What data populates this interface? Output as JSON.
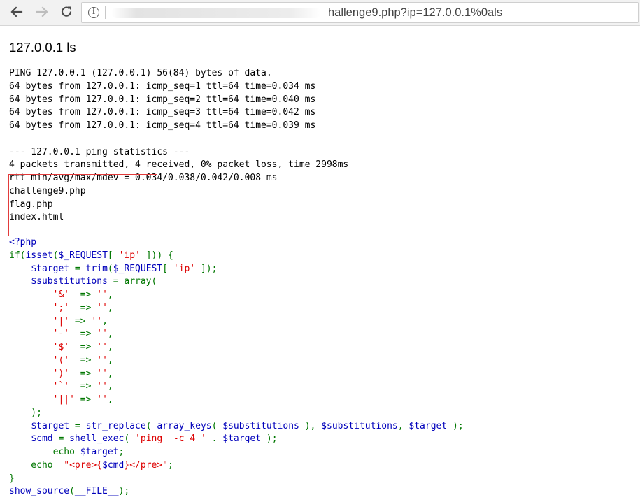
{
  "browser": {
    "url_visible": "hallenge9.php?ip=127.0.0.1%0als",
    "icons": {
      "back": "back-arrow-icon",
      "forward": "forward-arrow-icon",
      "reload": "reload-icon",
      "info": "info-icon"
    },
    "info_glyph": "i"
  },
  "page": {
    "heading": "127.0.0.1 ls",
    "output_lines": [
      "PING 127.0.0.1 (127.0.0.1) 56(84) bytes of data.",
      "64 bytes from 127.0.0.1: icmp_seq=1 ttl=64 time=0.034 ms",
      "64 bytes from 127.0.0.1: icmp_seq=2 ttl=64 time=0.040 ms",
      "64 bytes from 127.0.0.1: icmp_seq=3 ttl=64 time=0.042 ms",
      "64 bytes from 127.0.0.1: icmp_seq=4 ttl=64 time=0.039 ms",
      "",
      "--- 127.0.0.1 ping statistics ---",
      "4 packets transmitted, 4 received, 0% packet loss, time 2998ms",
      "rtt min/avg/max/mdev = 0.034/0.038/0.042/0.008 ms",
      "challenge9.php",
      "flag.php",
      "index.html"
    ],
    "highlight_color": "#e23b3b"
  },
  "source": {
    "colors": {
      "default": "#0000bb",
      "keyword": "#007700",
      "string": "#dd0000"
    },
    "lines": [
      [
        [
          "default",
          "<?php"
        ]
      ],
      [
        [
          "keyword",
          "if("
        ],
        [
          "default",
          "isset"
        ],
        [
          "keyword",
          "("
        ],
        [
          "default",
          "$_REQUEST"
        ],
        [
          "keyword",
          "[ "
        ],
        [
          "string",
          "'ip'"
        ],
        [
          "keyword",
          " ])) {"
        ]
      ],
      [
        [
          "keyword",
          "    "
        ],
        [
          "default",
          "$target"
        ],
        [
          "keyword",
          " = "
        ],
        [
          "default",
          "trim"
        ],
        [
          "keyword",
          "("
        ],
        [
          "default",
          "$_REQUEST"
        ],
        [
          "keyword",
          "[ "
        ],
        [
          "string",
          "'ip'"
        ],
        [
          "keyword",
          " ]);"
        ]
      ],
      [
        [
          "keyword",
          "    "
        ],
        [
          "default",
          "$substitutions"
        ],
        [
          "keyword",
          " = array("
        ]
      ],
      [
        [
          "keyword",
          "        "
        ],
        [
          "string",
          "'&'"
        ],
        [
          "keyword",
          "  => "
        ],
        [
          "string",
          "''"
        ],
        [
          "keyword",
          ","
        ]
      ],
      [
        [
          "keyword",
          "        "
        ],
        [
          "string",
          "';'"
        ],
        [
          "keyword",
          "  => "
        ],
        [
          "string",
          "''"
        ],
        [
          "keyword",
          ","
        ]
      ],
      [
        [
          "keyword",
          "        "
        ],
        [
          "string",
          "'|'"
        ],
        [
          "keyword",
          " => "
        ],
        [
          "string",
          "''"
        ],
        [
          "keyword",
          ","
        ]
      ],
      [
        [
          "keyword",
          "        "
        ],
        [
          "string",
          "'-'"
        ],
        [
          "keyword",
          "  => "
        ],
        [
          "string",
          "''"
        ],
        [
          "keyword",
          ","
        ]
      ],
      [
        [
          "keyword",
          "        "
        ],
        [
          "string",
          "'$'"
        ],
        [
          "keyword",
          "  => "
        ],
        [
          "string",
          "''"
        ],
        [
          "keyword",
          ","
        ]
      ],
      [
        [
          "keyword",
          "        "
        ],
        [
          "string",
          "'('"
        ],
        [
          "keyword",
          "  => "
        ],
        [
          "string",
          "''"
        ],
        [
          "keyword",
          ","
        ]
      ],
      [
        [
          "keyword",
          "        "
        ],
        [
          "string",
          "')'"
        ],
        [
          "keyword",
          "  => "
        ],
        [
          "string",
          "''"
        ],
        [
          "keyword",
          ","
        ]
      ],
      [
        [
          "keyword",
          "        "
        ],
        [
          "string",
          "'`'"
        ],
        [
          "keyword",
          "  => "
        ],
        [
          "string",
          "''"
        ],
        [
          "keyword",
          ","
        ]
      ],
      [
        [
          "keyword",
          "        "
        ],
        [
          "string",
          "'||'"
        ],
        [
          "keyword",
          " => "
        ],
        [
          "string",
          "''"
        ],
        [
          "keyword",
          ","
        ]
      ],
      [
        [
          "keyword",
          "    );"
        ]
      ],
      [
        [
          "keyword",
          "    "
        ],
        [
          "default",
          "$target"
        ],
        [
          "keyword",
          " = "
        ],
        [
          "default",
          "str_replace"
        ],
        [
          "keyword",
          "( "
        ],
        [
          "default",
          "array_keys"
        ],
        [
          "keyword",
          "( "
        ],
        [
          "default",
          "$substitutions"
        ],
        [
          "keyword",
          " ), "
        ],
        [
          "default",
          "$substitutions"
        ],
        [
          "keyword",
          ", "
        ],
        [
          "default",
          "$target"
        ],
        [
          "keyword",
          " );"
        ]
      ],
      [
        [
          "keyword",
          "    "
        ],
        [
          "default",
          "$cmd"
        ],
        [
          "keyword",
          " = "
        ],
        [
          "default",
          "shell_exec"
        ],
        [
          "keyword",
          "( "
        ],
        [
          "string",
          "'ping  -c 4 '"
        ],
        [
          "keyword",
          " . "
        ],
        [
          "default",
          "$target"
        ],
        [
          "keyword",
          " );"
        ]
      ],
      [
        [
          "keyword",
          "        echo "
        ],
        [
          "default",
          "$target"
        ],
        [
          "keyword",
          ";"
        ]
      ],
      [
        [
          "keyword",
          "    echo  "
        ],
        [
          "string",
          "\"<pre>{"
        ],
        [
          "default",
          "$cmd"
        ],
        [
          "string",
          "}</pre>\""
        ],
        [
          "keyword",
          ";"
        ]
      ],
      [
        [
          "keyword",
          "}"
        ]
      ],
      [
        [
          "default",
          "show_source"
        ],
        [
          "keyword",
          "("
        ],
        [
          "default",
          "__FILE__"
        ],
        [
          "keyword",
          ");"
        ]
      ]
    ]
  }
}
